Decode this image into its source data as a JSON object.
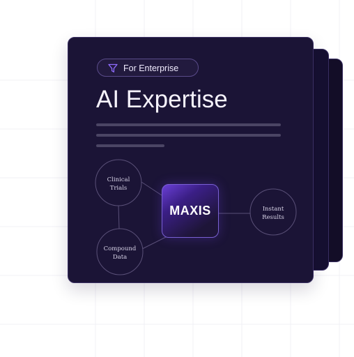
{
  "card": {
    "badge_label": "For Enterprise",
    "title": "AI Expertise"
  },
  "diagram": {
    "nodes": [
      {
        "label_lines": [
          "Clinical",
          "Trials"
        ]
      },
      {
        "label_lines": [
          "Compound",
          "Data"
        ]
      },
      {
        "label_lines": [
          "Instant",
          "Results"
        ]
      }
    ],
    "center_logo_text": "MAXIS"
  },
  "icons": {
    "badge_icon": "filter-icon"
  },
  "colors": {
    "card_background": "#1b1436",
    "accent_purple": "#7b4dff",
    "text_primary": "#f5f2fb",
    "grid_lines": "#efedf5"
  }
}
